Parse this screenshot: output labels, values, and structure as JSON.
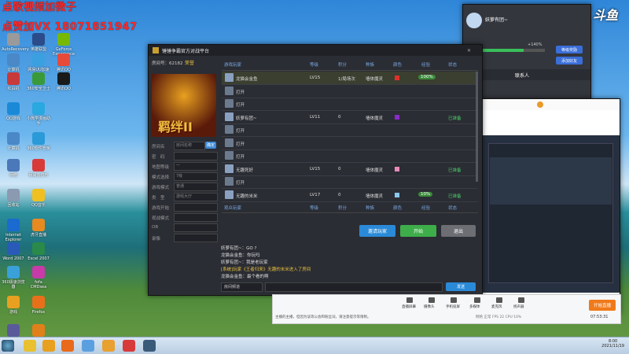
{
  "overlay": {
    "line1": "点歌视频加微子",
    "line2": "点赞加VX 18071851947"
  },
  "desktop_icons": [
    {
      "label": "AutoRecovery",
      "color": "#9a9a9a"
    },
    {
      "label": "英雄联盟",
      "color": "#2b4b8a"
    },
    {
      "label": "GeForce Experience",
      "color": "#76b900"
    },
    {
      "label": "计算机",
      "color": "#4a88c8"
    },
    {
      "label": "网易UU加速器",
      "color": "#3aa0e0"
    },
    {
      "label": "腾讯QQ",
      "color": "#e84a3a"
    },
    {
      "label": "红白机",
      "color": "#c83a3a"
    },
    {
      "label": "360安全卫士",
      "color": "#3a9a3a"
    },
    {
      "label": "腾讯QQ",
      "color": "#1a1a1a"
    },
    {
      "label": "QQ游戏",
      "color": "#1a8ad8"
    },
    {
      "label": "小熊学漫画助手",
      "color": "#2aa8e0"
    },
    {
      "label": "计算机",
      "color": "#4a88c8"
    },
    {
      "label": "360软件管家",
      "color": "#2a9ad8"
    },
    {
      "label": "网络",
      "color": "#4a78b8"
    },
    {
      "label": "网易云音乐",
      "color": "#d83a3a"
    },
    {
      "label": "回收站",
      "color": "#8a9ab0"
    },
    {
      "label": "QQ音乐",
      "color": "#f0c020"
    },
    {
      "label": "Internet Explorer",
      "color": "#1a6ad0"
    },
    {
      "label": "虎牙直播",
      "color": "#e88a20"
    },
    {
      "label": "Word 2007",
      "color": "#2a5ab8"
    },
    {
      "label": "Excel 2007",
      "color": "#2a8a4a"
    },
    {
      "label": "360极速浏览器",
      "color": "#3aa0d8"
    },
    {
      "label": "fofa CMDsea",
      "color": "#c83aa8"
    },
    {
      "label": "游戏",
      "color": "#e8a020"
    },
    {
      "label": "Firefox",
      "color": "#e8701a"
    },
    {
      "label": "美国大学",
      "color": "#5a5a9a"
    },
    {
      "label": "说明 Firefox 数据",
      "color": "#e0801a"
    }
  ],
  "main_window": {
    "title": "锤锤争霸官方对战平台",
    "room_label": "房间号：62182",
    "room_tag": "荣誉",
    "banner_text": "羁绊II",
    "side_fields": [
      {
        "label": "房间名",
        "value": "房间名称"
      },
      {
        "label": "密　码",
        "value": ""
      },
      {
        "label": "地图等级",
        "value": "一"
      },
      {
        "label": "模式选择",
        "value": "7级"
      },
      {
        "label": "游戏模式",
        "value": "普通"
      },
      {
        "label": "类　型",
        "value": "游戏大厅"
      },
      {
        "label": "游戏开始",
        "value": ""
      },
      {
        "label": "观战模式",
        "value": ""
      },
      {
        "label": "OB",
        "value": ""
      },
      {
        "label": "录像",
        "value": ""
      }
    ],
    "confirm_btn": "确定",
    "columns": [
      "游戏玩家",
      "等级",
      "积分",
      "种族",
      "颜色",
      "经验",
      "状态"
    ],
    "players": [
      {
        "name": "龙猫会金鱼",
        "level": "LV15",
        "score": "1/局场次",
        "race": "墙体魔灵",
        "color": "#e0302a",
        "exp": "100%",
        "status": ""
      },
      {
        "name": "打开",
        "level": "",
        "score": "",
        "race": "",
        "color": "",
        "exp": "",
        "status": ""
      },
      {
        "name": "打开",
        "level": "",
        "score": "",
        "race": "",
        "color": "",
        "exp": "",
        "status": ""
      },
      {
        "name": "妖萝有团~",
        "level": "LV11",
        "score": "0",
        "race": "墙体魔灵",
        "color": "#8a2ac8",
        "exp": "",
        "status": "已准备"
      },
      {
        "name": "打开",
        "level": "",
        "score": "",
        "race": "",
        "color": "",
        "exp": "",
        "status": ""
      },
      {
        "name": "打开",
        "level": "",
        "score": "",
        "race": "",
        "color": "",
        "exp": "",
        "status": ""
      },
      {
        "name": "打开",
        "level": "",
        "score": "",
        "race": "",
        "color": "",
        "exp": "",
        "status": ""
      },
      {
        "name": "无趣死好",
        "level": "LV15",
        "score": "0",
        "race": "墙体魔灵",
        "color": "#e88ab8",
        "exp": "",
        "status": "已准备"
      },
      {
        "name": "打开",
        "level": "",
        "score": "",
        "race": "",
        "color": "",
        "exp": "",
        "status": ""
      },
      {
        "name": "无趣的米米",
        "level": "LV17",
        "score": "0",
        "race": "墙体魔灵",
        "color": "#8ac8f0",
        "exp": "10%",
        "status": "已准备"
      }
    ],
    "observer_columns": [
      "观众玩家",
      "等级",
      "积分",
      "种族",
      "颜色",
      "经验",
      "状态"
    ],
    "btn_invite": "邀请玩家",
    "btn_start": "开始",
    "btn_exit": "退出",
    "chat_lines": [
      "妖萝有团~：GO ?",
      "龙猫会金鱼：你玩吗",
      "妖萝有团~：我是老玩家",
      "[系统]玩家《王者归来》无趣的米米进入了房间",
      "龙猫会金鱼：最个看的啊"
    ],
    "chat_channel": "房间频道",
    "send_btn": "发送"
  },
  "qq_panel": {
    "name": "妖萝有团~",
    "btn1": "等级奖励",
    "btn2": "添加好友",
    "tab": "联系人",
    "score_text": "+140%"
  },
  "stream_bar": {
    "left_note": "主播的主播，但因为该等公会和粉丝词，请注意提示等限制。",
    "items": [
      "直播屏幕",
      "摄像头",
      "手机投屏",
      "多媒体",
      "麦克风",
      "扬声器"
    ],
    "start_btn": "开始直播",
    "status": "网络 正常  FPS 22  CPU 10%",
    "time": "07:53:31"
  },
  "douyu_logo": "斗鱼",
  "taskbar": {
    "clock_time": "8:00",
    "clock_date": "2021/11/19"
  }
}
